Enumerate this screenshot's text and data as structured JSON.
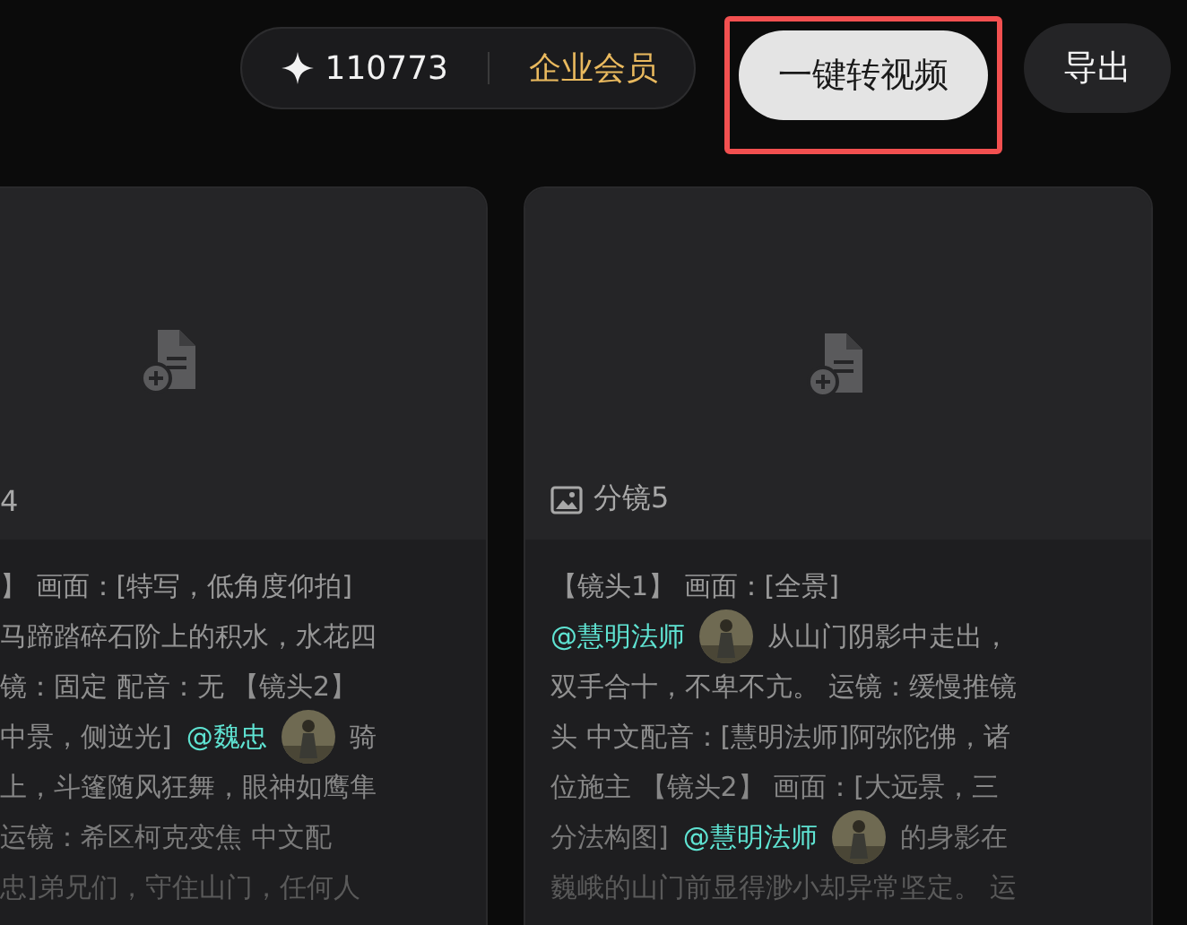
{
  "toolbar": {
    "credits": "110773",
    "membership": "企业会员",
    "buttons": [
      {
        "label": "一键转视频",
        "kind": "primary",
        "highlighted": true
      },
      {
        "label": "导出",
        "kind": "secondary",
        "highlighted": false
      }
    ]
  },
  "cards": [
    {
      "label": "4",
      "label_icon": false,
      "lines": [
        [
          {
            "kind": "text",
            "text": "】 画面：[特写，低角度仰拍]"
          }
        ],
        [
          {
            "kind": "text",
            "text": "马蹄踏碎石阶上的积水，水花四"
          }
        ],
        [
          {
            "kind": "text",
            "text": "镜：固定 配音：无 【镜头2】"
          }
        ],
        [
          {
            "kind": "text",
            "text": "中景，侧逆光]"
          },
          {
            "kind": "mention",
            "text": "@魏忠"
          },
          {
            "kind": "text",
            "text": "骑"
          }
        ],
        [
          {
            "kind": "text",
            "text": "上，斗篷随风狂舞，眼神如鹰隼"
          }
        ],
        [
          {
            "kind": "text",
            "text": "运镜：希区柯克变焦 中文配"
          }
        ],
        [
          {
            "kind": "text",
            "text": "忠]弟兄们，守住山门，任何人"
          }
        ]
      ]
    },
    {
      "label": "分镜5",
      "label_icon": true,
      "lines": [
        [
          {
            "kind": "text",
            "text": "【镜头1】 画面：[全景]"
          }
        ],
        [
          {
            "kind": "mention",
            "text": "@慧明法师"
          },
          {
            "kind": "text",
            "text": "从山门阴影中走出，"
          }
        ],
        [
          {
            "kind": "text",
            "text": "双手合十，不卑不亢。 运镜：缓慢推镜"
          }
        ],
        [
          {
            "kind": "text",
            "text": "头 中文配音：[慧明法师]阿弥陀佛，诸"
          }
        ],
        [
          {
            "kind": "text",
            "text": "位施主 【镜头2】 画面：[大远景，三"
          }
        ],
        [
          {
            "kind": "text",
            "text": "分法构图]"
          },
          {
            "kind": "mention",
            "text": "@慧明法师"
          },
          {
            "kind": "text",
            "text": "的身影在"
          }
        ],
        [
          {
            "kind": "text",
            "text": "巍峨的山门前显得渺小却异常坚定。 运"
          }
        ]
      ]
    }
  ]
}
